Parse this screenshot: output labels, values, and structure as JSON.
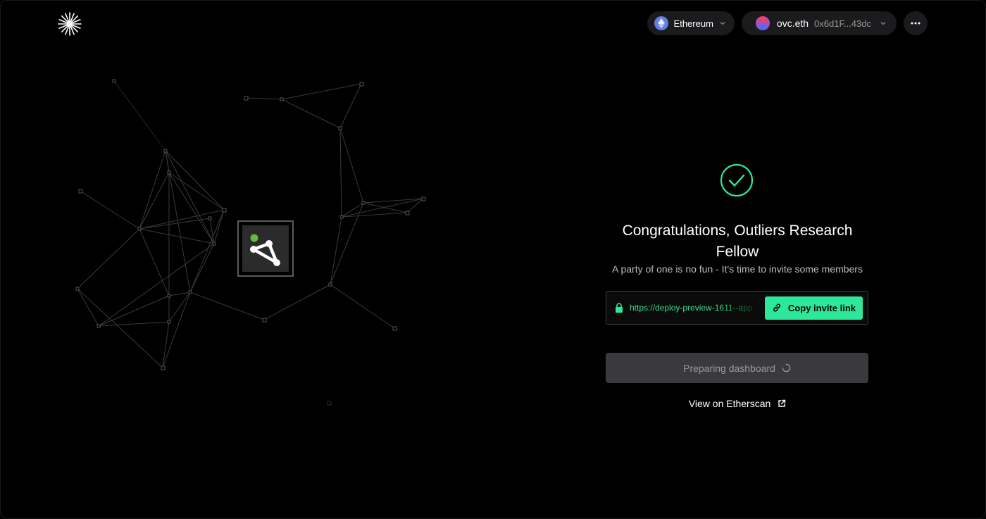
{
  "header": {
    "logo_icon": "sunburst-logo-icon",
    "network": {
      "label": "Ethereum",
      "icon": "ethereum-icon"
    },
    "account": {
      "ens": "ovc.eth",
      "address": "0x6d1F...43dc",
      "icon": "avatar-icon"
    },
    "more_icon": "more-dots-icon"
  },
  "main": {
    "success_icon": "check-circle-icon",
    "title": "Congratulations, Outliers Research Fellow",
    "subtitle": "A party of one is no fun - It's time to invite some members",
    "invite": {
      "url": "https://deploy-preview-1611--app",
      "copy_label": "Copy invite link"
    },
    "preparing_label": "Preparing dashboard",
    "etherscan_label": "View on Etherscan"
  },
  "colors": {
    "accent_green": "#2ee89a",
    "background": "#000000",
    "indicator_dot": "#5fbf3a"
  }
}
